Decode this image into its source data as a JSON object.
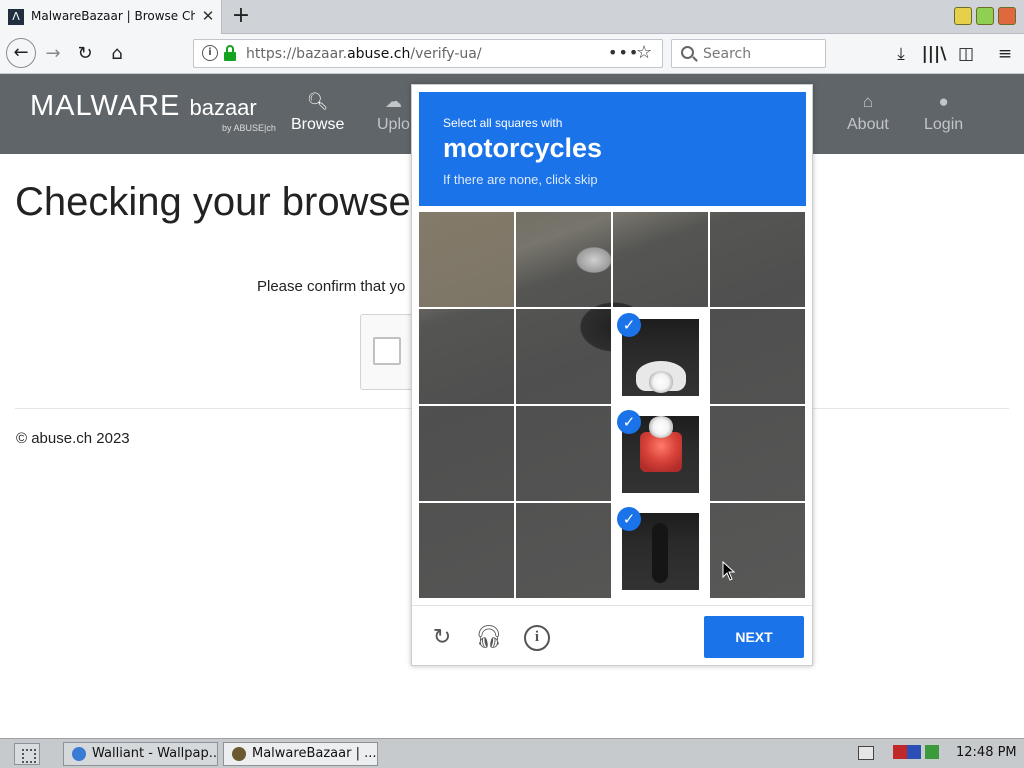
{
  "browser": {
    "tab_title": "MalwareBazaar | Browse Ch",
    "tab_favicon": "Λ",
    "url_host": "https://bazaar.",
    "url_domain": "abuse.ch",
    "url_path": "/verify-ua/",
    "search_placeholder": "Search",
    "icons": [
      "back-arrow-icon",
      "forward-arrow-icon",
      "reload-icon",
      "home-icon",
      "info-icon",
      "lock-icon",
      "more-icon",
      "star-icon",
      "search-icon",
      "download-icon",
      "library-icon",
      "sidebar-icon",
      "menu-icon"
    ]
  },
  "site": {
    "logo_main": "MALWARE",
    "logo_sub": "bazaar",
    "logo_by": "by ABUSE|ch",
    "nav": [
      {
        "label": "Browse",
        "icon": "search-icon"
      },
      {
        "label": "Uplo",
        "icon": "cloud-upload-icon"
      },
      {
        "label": "About",
        "icon": "bank-icon"
      },
      {
        "label": "Login",
        "icon": "user-icon"
      }
    ],
    "page_title": "Checking your browse",
    "confirm_text": "Please confirm that yo",
    "copyright": "© abuse.ch 2023"
  },
  "challenge": {
    "line1": "Select all squares with",
    "keyword": "motorcycles",
    "line3": "If there are none, click skip",
    "selected_tiles": [
      6,
      10,
      14
    ],
    "next_label": "NEXT",
    "accent": "#1a73e8"
  },
  "taskbar": {
    "tasks": [
      "Walliant - Wallpap...",
      "MalwareBazaar | ..."
    ],
    "clock": "12:48 PM"
  }
}
